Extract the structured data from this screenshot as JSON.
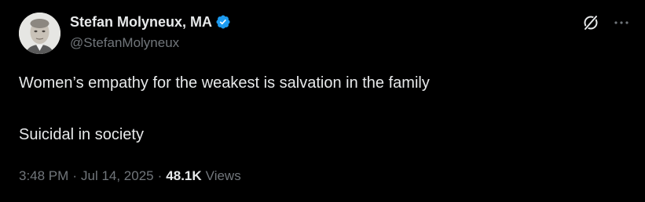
{
  "author": {
    "display_name": "Stefan Molyneux, MA",
    "handle": "@StefanMolyneux",
    "verified": true
  },
  "icons": {
    "verified": "verified-badge-icon",
    "grok": "grok-icon",
    "more": "more-icon",
    "avatar": "avatar-photo"
  },
  "colors": {
    "background": "#000000",
    "text_primary": "#e7e9ea",
    "text_secondary": "#71767b",
    "verified": "#1d9bf0"
  },
  "tweet": {
    "lines": [
      "Women’s empathy for the weakest is salvation in the family",
      "Suicidal in society"
    ]
  },
  "meta": {
    "time": "3:48 PM",
    "separator": "·",
    "date": "Jul 14, 2025",
    "views_count": "48.1K",
    "views_label": "Views"
  }
}
